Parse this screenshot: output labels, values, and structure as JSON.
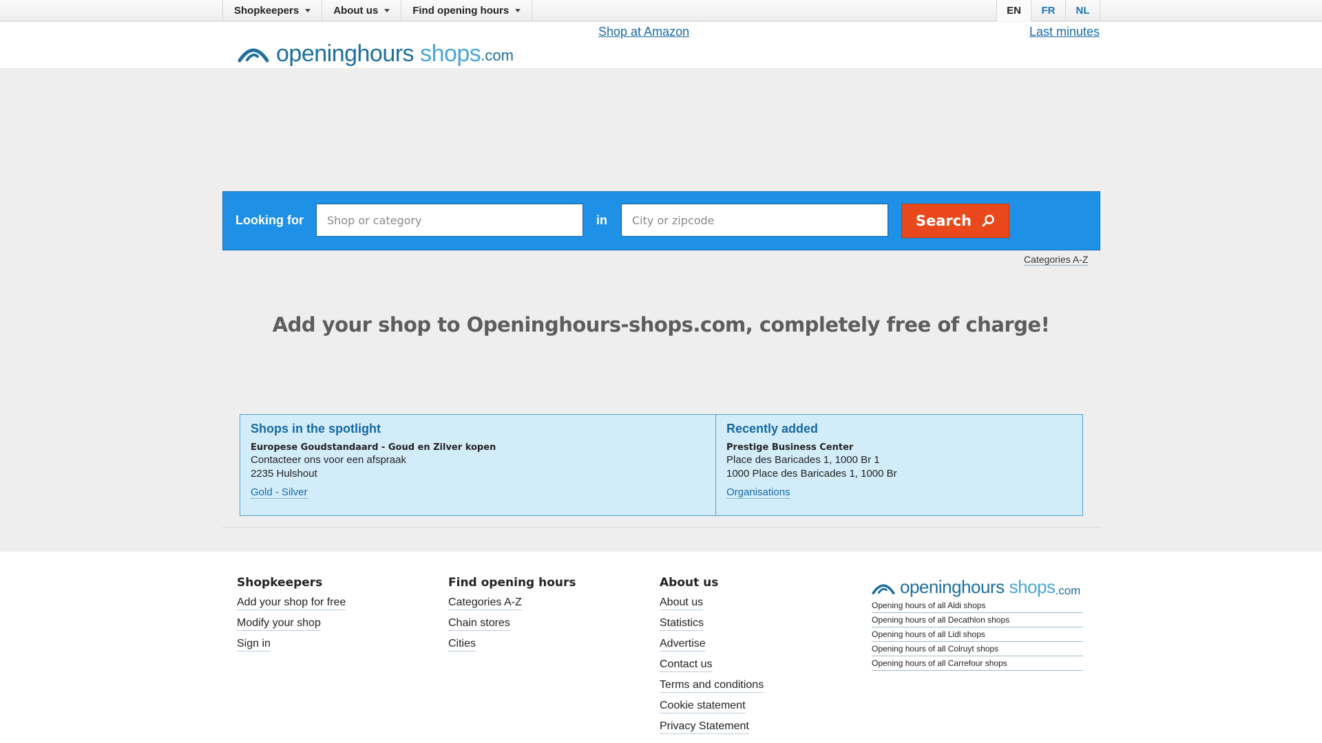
{
  "topnav": {
    "items": [
      {
        "label": "Shopkeepers"
      },
      {
        "label": "About us"
      },
      {
        "label": "Find opening hours"
      }
    ],
    "languages": [
      {
        "label": "EN",
        "active": true
      },
      {
        "label": "FR",
        "active": false
      },
      {
        "label": "NL",
        "active": false
      }
    ]
  },
  "header": {
    "logo": {
      "part1": "openinghours",
      "part2": "shops",
      "part3": ".com"
    },
    "link_amazon": "Shop at Amazon",
    "link_lastminutes": "Last minutes"
  },
  "search": {
    "looking_for_label": "Looking for",
    "shop_placeholder": "Shop or category",
    "in_label": "in",
    "city_placeholder": "City or zipcode",
    "button_label": "Search",
    "categories_link": "Categories A-Z"
  },
  "headline": "Add your shop to Openinghours-shops.com, completely free of charge!",
  "spotlight": {
    "title": "Shops in the spotlight",
    "name": "Europese Goudstandaard - Goud en Zilver kopen",
    "line1": "Contacteer ons voor een afspraak",
    "line2": "2235 Hulshout",
    "category": "Gold - Silver"
  },
  "recent": {
    "title": "Recently added",
    "name": "Prestige Business Center",
    "line1": "Place des Baricades 1, 1000 Br 1",
    "line2": "1000 Place des Baricades 1, 1000 Br",
    "category": "Organisations"
  },
  "footer": {
    "shopkeepers": {
      "title": "Shopkeepers",
      "links": [
        "Add your shop for free",
        "Modify your shop",
        "Sign in"
      ]
    },
    "find": {
      "title": "Find opening hours",
      "links": [
        "Categories A-Z",
        "Chain stores",
        "Cities"
      ]
    },
    "about": {
      "title": "About us",
      "links": [
        "About us",
        "Statistics",
        "Advertise",
        "Contact us",
        "Terms and conditions",
        "Cookie statement",
        "Privacy Statement"
      ]
    },
    "logo": {
      "part1": "openinghours",
      "part2": "shops",
      "part3": ".com"
    },
    "chain_links": [
      "Opening hours of all Aldi shops",
      "Opening hours of all Decathlon shops",
      "Opening hours of all Lidl shops",
      "Opening hours of all Colruyt shops",
      "Opening hours of all Carrefour shops"
    ]
  },
  "colors": {
    "search_band": "#1e90e6",
    "search_button": "#e8481c",
    "spotlight_bg": "#d3ecfa",
    "link_blue": "#1669a3"
  }
}
